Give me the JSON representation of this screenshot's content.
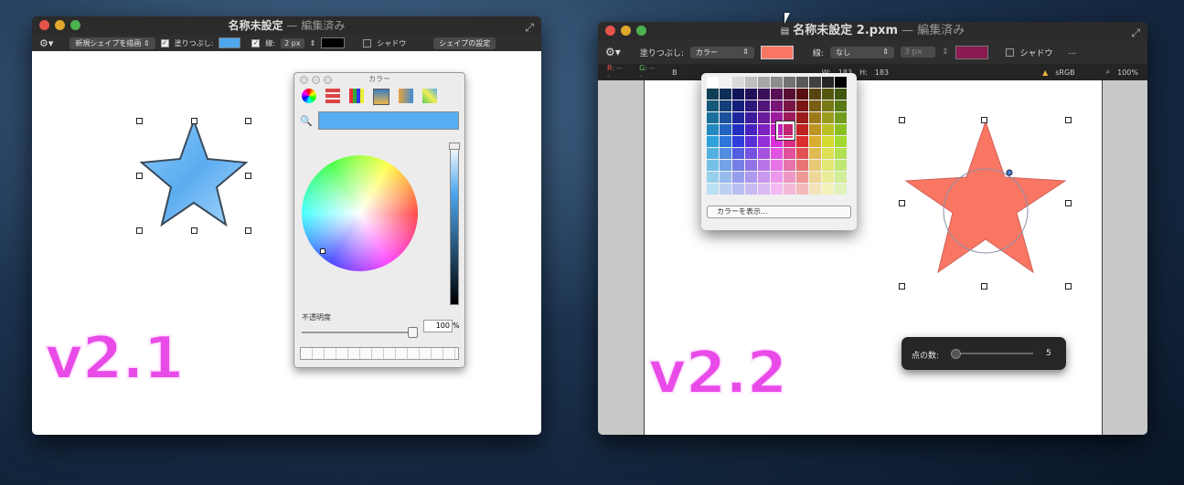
{
  "left": {
    "title": "名称未設定",
    "title_sep": " — ",
    "title_status": "編集済み",
    "toolbar": {
      "shape_menu": "新規シェイプを描画",
      "fill_label": "塗りつぶし:",
      "fill_color": "#4da6ee",
      "stroke_label": "線:",
      "stroke_width": "2 px",
      "stroke_color": "#000000",
      "shadow_label": "シャドウ",
      "shape_settings": "シェイプの設定"
    },
    "color_panel": {
      "title": "カラー",
      "current_color": "#55aef3",
      "opacity_label": "不透明度",
      "opacity_value": "100",
      "opacity_unit": "%"
    },
    "version_label": "v2.1"
  },
  "right": {
    "title": "名称未設定 2.pxm",
    "title_sep": " — ",
    "title_status": "編集済み",
    "toolbar": {
      "fill_label": "塗りつぶし:",
      "fill_mode": "カラー",
      "fill_color": "#f97663",
      "stroke_label": "線:",
      "stroke_mode": "なし",
      "stroke_width": "3 px",
      "stroke_color": "#8a1a50",
      "shadow_label": "シャドウ",
      "more": "..."
    },
    "infobar": {
      "r_label": "R",
      "r_value": ": ---",
      "g_label": "G",
      "g_value": ": ---",
      "b_label": "B",
      "w_label": "W:",
      "w_value": "183",
      "h_label": "H:",
      "h_value": "183",
      "colorspace": "sRGB",
      "zoom": "100%"
    },
    "popover": {
      "show_colors": "カラーを表示..."
    },
    "hud": {
      "points_label": "点の数:",
      "points_value": "5",
      "points_fraction": 0.05
    },
    "version_label": "v2.2"
  }
}
